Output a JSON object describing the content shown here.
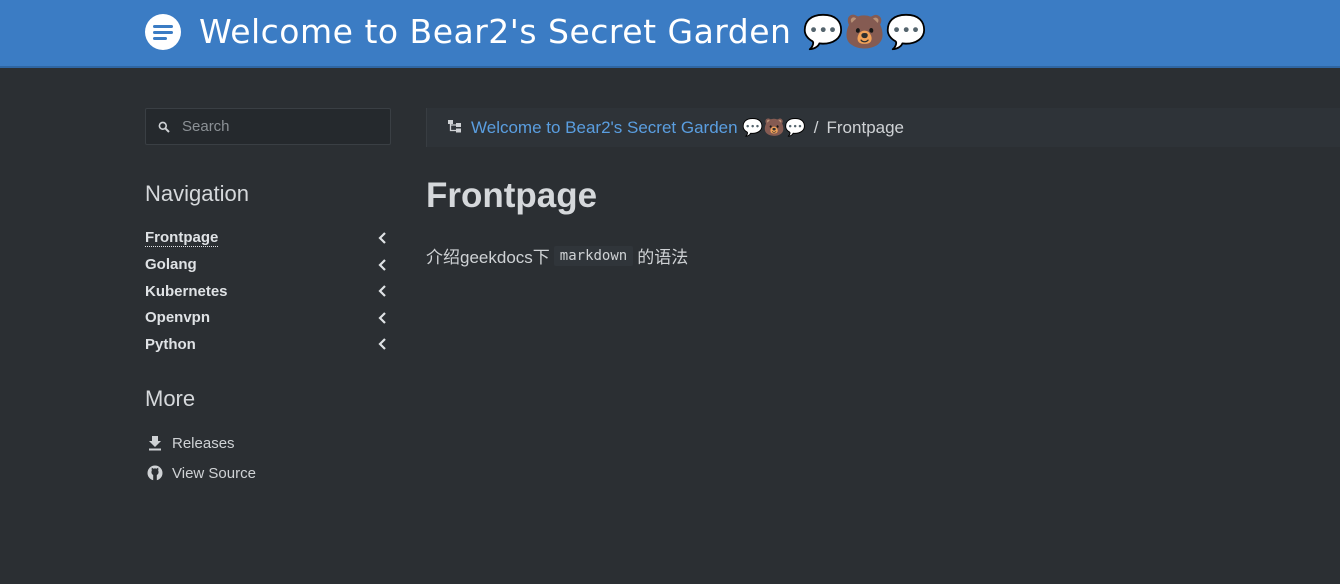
{
  "header": {
    "title": "Welcome to Bear2's Secret Garden 💬🐻💬",
    "logo_icon": "menu-lines-icon"
  },
  "search": {
    "placeholder": "Search"
  },
  "sidebar": {
    "navigation_title": "Navigation",
    "nav_items": [
      {
        "label": "Frontpage",
        "active": true
      },
      {
        "label": "Golang",
        "active": false
      },
      {
        "label": "Kubernetes",
        "active": false
      },
      {
        "label": "Openvpn",
        "active": false
      },
      {
        "label": "Python",
        "active": false
      }
    ],
    "more_title": "More",
    "more_items": [
      {
        "label": "Releases",
        "icon": "download-icon"
      },
      {
        "label": "View Source",
        "icon": "github-icon"
      }
    ]
  },
  "breadcrumb": {
    "home": "Welcome to Bear2's Secret Garden 💬🐻💬",
    "separator": "/",
    "current": "Frontpage"
  },
  "main": {
    "title": "Frontpage",
    "intro_before": "介绍geekdocs下",
    "intro_code": "markdown",
    "intro_after": "的语法"
  },
  "colors": {
    "header_bg": "#3b7cc4",
    "page_bg": "#2b2f33",
    "link": "#5a9ee0"
  }
}
